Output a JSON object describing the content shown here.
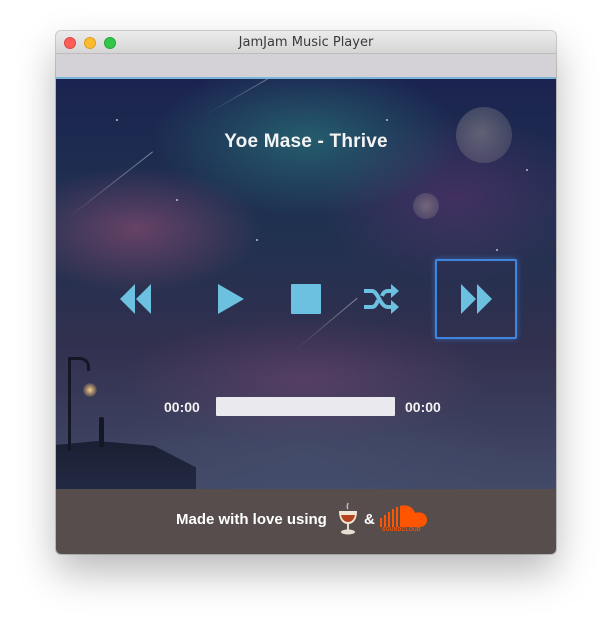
{
  "window": {
    "title": "JamJam Music Player"
  },
  "player": {
    "track_title": "Yoe Mase - Thrive",
    "current_time": "00:00",
    "total_time": "00:00",
    "progress": 0
  },
  "controls": {
    "rewind_icon": "rewind-icon",
    "play_icon": "play-icon",
    "stop_icon": "stop-icon",
    "shuffle_icon": "shuffle-icon",
    "forward_icon": "fast-forward-icon"
  },
  "footer": {
    "text": "Made with love using",
    "ampersand": "&",
    "soundcloud_wordmark": "SOUNDCLOUD"
  },
  "colors": {
    "accent": "#6cc0e0",
    "focus_ring": "#3f86e0",
    "footer_bg": "#564d4c",
    "soundcloud": "#ff5500"
  }
}
